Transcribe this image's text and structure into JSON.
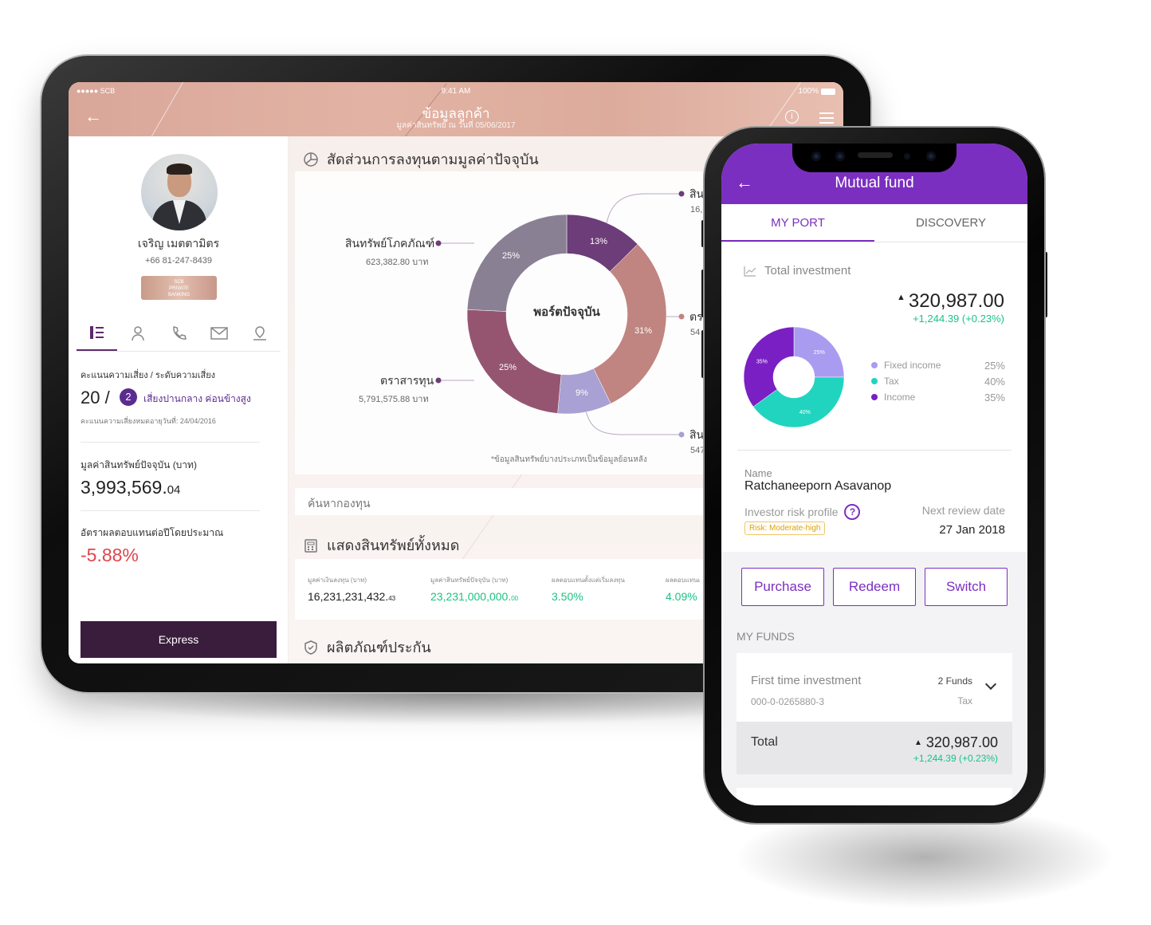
{
  "colors": {
    "tablet_header": "#dcab9c",
    "tablet_accent": "#5c2b6a",
    "negative": "#e0454c",
    "positive": "#1bc283",
    "phone_primary": "#7b2fc0",
    "express_button": "#3a1d3c"
  },
  "tablet": {
    "status": {
      "carrier": "●●●●● SCB",
      "time": "9:41 AM",
      "battery": "100%"
    },
    "header": {
      "title": "ข้อมูลลูกค้า",
      "subtitle": "มูลค่าสินทรัพย์ ณ วันที่ 05/06/2017",
      "back_icon": "arrow-left-icon",
      "info_icon": "info-icon",
      "menu_icon": "menu-icon"
    },
    "customer": {
      "name": "เจริญ เมตตามิตร",
      "phone": "+66 81-247-8439",
      "badge": [
        "SCB",
        "PRIVATE",
        "BANKING"
      ],
      "tabs": [
        "list-icon",
        "person-icon",
        "phone-icon",
        "mail-icon",
        "location-icon"
      ],
      "risk_label": "คะแนนความเสี่ยง / ระดับความเสี่ยง",
      "risk_score": "20 /",
      "risk_level": "2",
      "risk_desc": "เสี่ยงปานกลาง ค่อนข้างสูง",
      "risk_date": "คะแนนความเสี่ยงหมดอายุวันที่: 24/04/2016",
      "asset_label": "มูลค่าสินทรัพย์ปัจจุบัน (บาท)",
      "asset_main": "3,993,569.",
      "asset_dec": "04",
      "return_label": "อัตราผลตอบแทนต่อปีโดยประมาณ",
      "return_value": "-5.88%",
      "express_button": "Express"
    },
    "allocation": {
      "title": "สัดส่วนการลงทุนตามมูลค่าปัจจุบัน",
      "center": "พอร์ตปัจจุบัน",
      "slices": [
        {
          "pct": "13%",
          "value": 13,
          "color": "#6c3d78"
        },
        {
          "pct": "31%",
          "value": 31,
          "color": "#c08580"
        },
        {
          "pct": "9%",
          "value": 9,
          "color": "#a9a0d3"
        },
        {
          "pct": "25%",
          "value": 25,
          "color": "#955570"
        },
        {
          "pct": "25%",
          "value": 25,
          "color": "#8a8094"
        }
      ],
      "labels": [
        {
          "name": "สินทรัพย์โภคภัณฑ์",
          "value": "623,382.80 บาท"
        },
        {
          "name": "ตราสารทุน",
          "value": "5,791,575.88 บาท"
        },
        {
          "name": "สิน",
          "value": "16,"
        },
        {
          "name": "ตร",
          "value": "54"
        },
        {
          "name": "สิน",
          "value": "547"
        }
      ],
      "note": "*ข้อมูลสินทรัพย์บางประเภทเป็นข้อมูลย้อนหลัง"
    },
    "search_placeholder": "ค้นหากองทุน",
    "assets": {
      "title": "แสดงสินทรัพย์ทั้งหมด",
      "items": [
        {
          "label": "มูลค่าเงินลงทุน (บาท)",
          "value": "16,231,231,432.",
          "dec": "43",
          "color": "#222222"
        },
        {
          "label": "มูลค่าสินทรัพย์ปัจจุบัน (บาท)",
          "value": "23,231,000,000.",
          "dec": "00",
          "color": "#1bc283"
        },
        {
          "label": "ผลตอบแทนตั้งแต่เริ่มลงทุน",
          "value": "3.50%",
          "dec": "",
          "color": "#1bc283"
        },
        {
          "label": "ผลตอบแทนเ",
          "value": "4.09%",
          "dec": "",
          "color": "#1bc283"
        }
      ]
    },
    "insurance_title": "ผลิตภัณฑ์ประกัน"
  },
  "phone": {
    "title": "Mutual fund",
    "tabs": [
      "MY PORT",
      "DISCOVERY"
    ],
    "total_investment_label": "Total investment",
    "total_value": "320,987.00",
    "total_change": "+1,244.39 (+0.23%)",
    "donut": [
      {
        "name": "Fixed income",
        "pct": "25%",
        "value": 25,
        "color": "#a99cf0"
      },
      {
        "name": "Tax",
        "pct": "40%",
        "value": 40,
        "color": "#20d4c0"
      },
      {
        "name": "Income",
        "pct": "35%",
        "value": 35,
        "color": "#7a1fc4"
      }
    ],
    "name_label": "Name",
    "name_value": "Ratchaneeporn Asavanop",
    "risk_profile_label": "Investor risk profile",
    "risk_tag": "Risk: Moderate-high",
    "next_review_label": "Next review date",
    "next_review_value": "27 Jan 2018",
    "buttons": [
      "Purchase",
      "Redeem",
      "Switch"
    ],
    "my_funds_label": "MY FUNDS",
    "fund": {
      "title": "First time investment",
      "account": "000-0-0265880-3",
      "count": "2 Funds",
      "type": "Tax"
    },
    "total_label": "Total",
    "total_row_value": "320,987.00",
    "total_row_change": "+1,244.39 (+0.23%)"
  }
}
